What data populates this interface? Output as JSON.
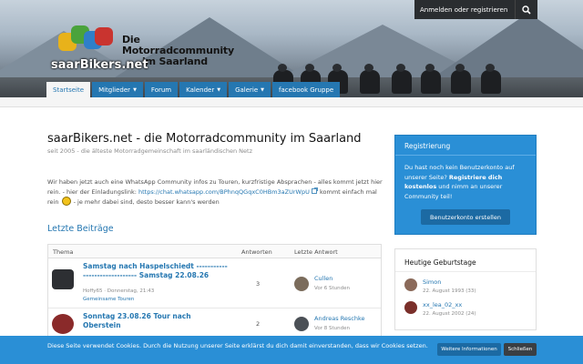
{
  "header": {
    "logo_title_line1": "Die Motorradcommunity",
    "logo_title_line2": "im Saarland",
    "logo_name": "saarBikers.net",
    "account_label": "Anmelden oder registrieren",
    "search_icon": "search-icon"
  },
  "nav": {
    "tabs": [
      {
        "label": "Startseite",
        "active": true,
        "dropdown": false
      },
      {
        "label": "Mitglieder",
        "active": false,
        "dropdown": true
      },
      {
        "label": "Forum",
        "active": false,
        "dropdown": false
      },
      {
        "label": "Kalender",
        "active": false,
        "dropdown": true
      },
      {
        "label": "Galerie",
        "active": false,
        "dropdown": true
      },
      {
        "label": "facebook Gruppe",
        "active": false,
        "dropdown": false
      }
    ],
    "dropdown_icon": "chevron-down-icon"
  },
  "main": {
    "title": "saarBikers.net - die Motorradcommunity im Saarland",
    "subtitle": "seit 2005 - die älteste Motorradgemeinschaft im saarländischen Netz",
    "intro_part1": "Wir haben jetzt auch eine WhatsApp Community infos zu Touren, kurzfristige Absprachen - alles kommt jetzt hier rein. - hier der Einladungslink: ",
    "intro_link": "https://chat.whatsapp.com/BPhnqQGqxC0HBm3aZUrWpU",
    "intro_part2": " kommt einfach mal rein ",
    "intro_part3": " - je mehr dabei sind, desto besser kann's werden",
    "section_title": "Letzte Beiträge",
    "table": {
      "col_topic": "Thema",
      "col_replies": "Antworten",
      "col_last": "Letzte Antwort",
      "rows": [
        {
          "title": "Samstag nach Haspelschiedt ------------------------------ Samstag 22.08.26",
          "author": "Hoffy65",
          "date": "Donnerstag, 21:43",
          "forum": "Gemeinsame Touren",
          "replies": "3",
          "last_user": "Cullen",
          "last_time": "Vor 6 Stunden"
        },
        {
          "title": "Sonntag 23.08.26 Tour nach Oberstein",
          "author": "",
          "date": "",
          "forum": "",
          "replies": "2",
          "last_user": "Andreas Reschke",
          "last_time": "Vor 8 Stunden"
        }
      ]
    }
  },
  "sidebar": {
    "register": {
      "title": "Registrierung",
      "text_part1": "Du hast noch kein Benutzerkonto auf unserer Seite? ",
      "text_bold": "Registriere dich kostenlos",
      "text_part2": " und nimm an unserer Community teil!",
      "button": "Benutzerkonto erstellen"
    },
    "birthdays": {
      "title": "Heutige Geburtstage",
      "people": [
        {
          "name": "Simon",
          "date": "22. August 1993 (33)"
        },
        {
          "name": "xx_lea_02_xx",
          "date": "22. August 2002 (24)"
        }
      ]
    }
  },
  "cookie": {
    "text": "Diese Seite verwendet Cookies. Durch die Nutzung unserer Seite erklärst du dich damit einverstanden, dass wir Cookies setzen.",
    "more_button": "Weitere Informationen",
    "close_button": "Schließen"
  },
  "colors": {
    "accent": "#2577b1",
    "register_bg": "#2a8fd6",
    "cookie_bg": "#2a8fd6"
  }
}
